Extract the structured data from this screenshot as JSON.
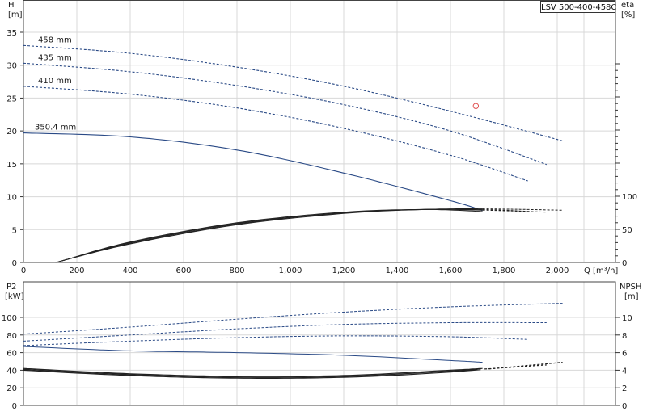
{
  "model_tag": "LSV 500-400-458C",
  "chart_data": [
    {
      "type": "line",
      "panel": "head-efficiency",
      "xlabel": "Q [m³/h]",
      "ylabel_left": [
        "H",
        "[m]"
      ],
      "ylabel_right": [
        "eta",
        "[%]"
      ],
      "xlim": [
        0,
        2200
      ],
      "ylim_left": [
        0,
        35
      ],
      "ylim_right": [
        0,
        100
      ],
      "x_ticks": [
        "0",
        "200",
        "400",
        "600",
        "800",
        "1,000",
        "1,200",
        "1,400",
        "1,600",
        "1,800",
        "2,000"
      ],
      "y_ticks_left": [
        "0",
        "5",
        "10",
        "15",
        "20",
        "25",
        "30",
        "35"
      ],
      "y_ticks_right": [
        "0",
        "50",
        "100"
      ],
      "grid": true,
      "head_series": [
        {
          "name": "458 mm",
          "x": [
            0,
            400,
            800,
            1200,
            1600,
            2020
          ],
          "y": [
            33.0,
            31.8,
            29.7,
            26.8,
            23.0,
            18.5
          ],
          "solid_to": 0
        },
        {
          "name": "435 mm",
          "x": [
            0,
            400,
            800,
            1200,
            1600,
            1960
          ],
          "y": [
            30.3,
            29.0,
            26.9,
            24.0,
            20.0,
            14.9
          ],
          "solid_to": 0
        },
        {
          "name": "410 mm",
          "x": [
            0,
            400,
            800,
            1200,
            1600,
            1890
          ],
          "y": [
            26.8,
            25.6,
            23.5,
            20.4,
            16.3,
            12.4
          ],
          "solid_to": 0
        },
        {
          "name": "350.4 mm",
          "x": [
            0,
            400,
            800,
            1200,
            1600,
            1720
          ],
          "y": [
            19.7,
            19.1,
            17.1,
            13.6,
            9.4,
            7.9
          ],
          "solid_to": 1720
        }
      ],
      "efficiency_series": [
        {
          "x": [
            150,
            400,
            800,
            1200,
            1500,
            1720
          ],
          "y": [
            3,
            31,
            60,
            76,
            80,
            77
          ],
          "solid_to": 1720
        },
        {
          "x": [
            140,
            400,
            800,
            1200,
            1500,
            1720,
            1960
          ],
          "y": [
            2,
            30,
            59,
            75,
            80,
            79,
            76
          ],
          "solid_to": 1720
        },
        {
          "x": [
            130,
            400,
            800,
            1200,
            1500,
            1720,
            1900
          ],
          "y": [
            1,
            29,
            58,
            75,
            80,
            80,
            77
          ],
          "solid_to": 1720
        },
        {
          "x": [
            120,
            400,
            800,
            1200,
            1500,
            1720,
            2020
          ],
          "y": [
            0,
            28,
            57,
            74,
            80,
            81,
            79
          ],
          "solid_to": 1720
        }
      ],
      "operating_point": {
        "x": 1695,
        "y": 23.8,
        "color": "#e05050"
      }
    },
    {
      "type": "line",
      "panel": "power-npsh",
      "ylabel_left": [
        "P2",
        "[kW]"
      ],
      "ylabel_right": [
        "NPSH",
        "[m]"
      ],
      "xlim": [
        0,
        2200
      ],
      "ylim_left": [
        0,
        120
      ],
      "ylim_right": [
        0,
        12
      ],
      "y_ticks_left": [
        "0",
        "20",
        "40",
        "60",
        "80",
        "100"
      ],
      "y_ticks_right": [
        "0",
        "2",
        "4",
        "6",
        "8",
        "10"
      ],
      "grid": true,
      "power_series": [
        {
          "name": "458 mm",
          "x": [
            0,
            400,
            800,
            1200,
            1600,
            2020
          ],
          "y": [
            81,
            89,
            98,
            106,
            112,
            116
          ],
          "solid_to": 0
        },
        {
          "name": "435 mm",
          "x": [
            0,
            400,
            800,
            1200,
            1600,
            1960
          ],
          "y": [
            73,
            80,
            87,
            92,
            94,
            94
          ],
          "solid_to": 0
        },
        {
          "name": "410 mm",
          "x": [
            0,
            400,
            800,
            1200,
            1600,
            1890
          ],
          "y": [
            68,
            73,
            77,
            79,
            78,
            75
          ],
          "solid_to": 0
        },
        {
          "name": "350.4 mm",
          "x": [
            0,
            400,
            800,
            1200,
            1600,
            1720
          ],
          "y": [
            67,
            62,
            60,
            57,
            51,
            49
          ],
          "solid_to": 1720
        }
      ],
      "npsh_series": [
        {
          "x": [
            0,
            400,
            800,
            1200,
            1600,
            1720
          ],
          "y": [
            4.2,
            3.6,
            3.3,
            3.4,
            4.0,
            4.2
          ],
          "solid_to": 1720
        },
        {
          "x": [
            0,
            400,
            800,
            1200,
            1600,
            1960
          ],
          "y": [
            4.1,
            3.5,
            3.2,
            3.3,
            3.9,
            4.6
          ],
          "solid_to": 1720
        },
        {
          "x": [
            0,
            400,
            800,
            1200,
            1600,
            2020
          ],
          "y": [
            4.0,
            3.4,
            3.1,
            3.2,
            3.8,
            4.9
          ],
          "solid_to": 1720
        }
      ]
    }
  ]
}
